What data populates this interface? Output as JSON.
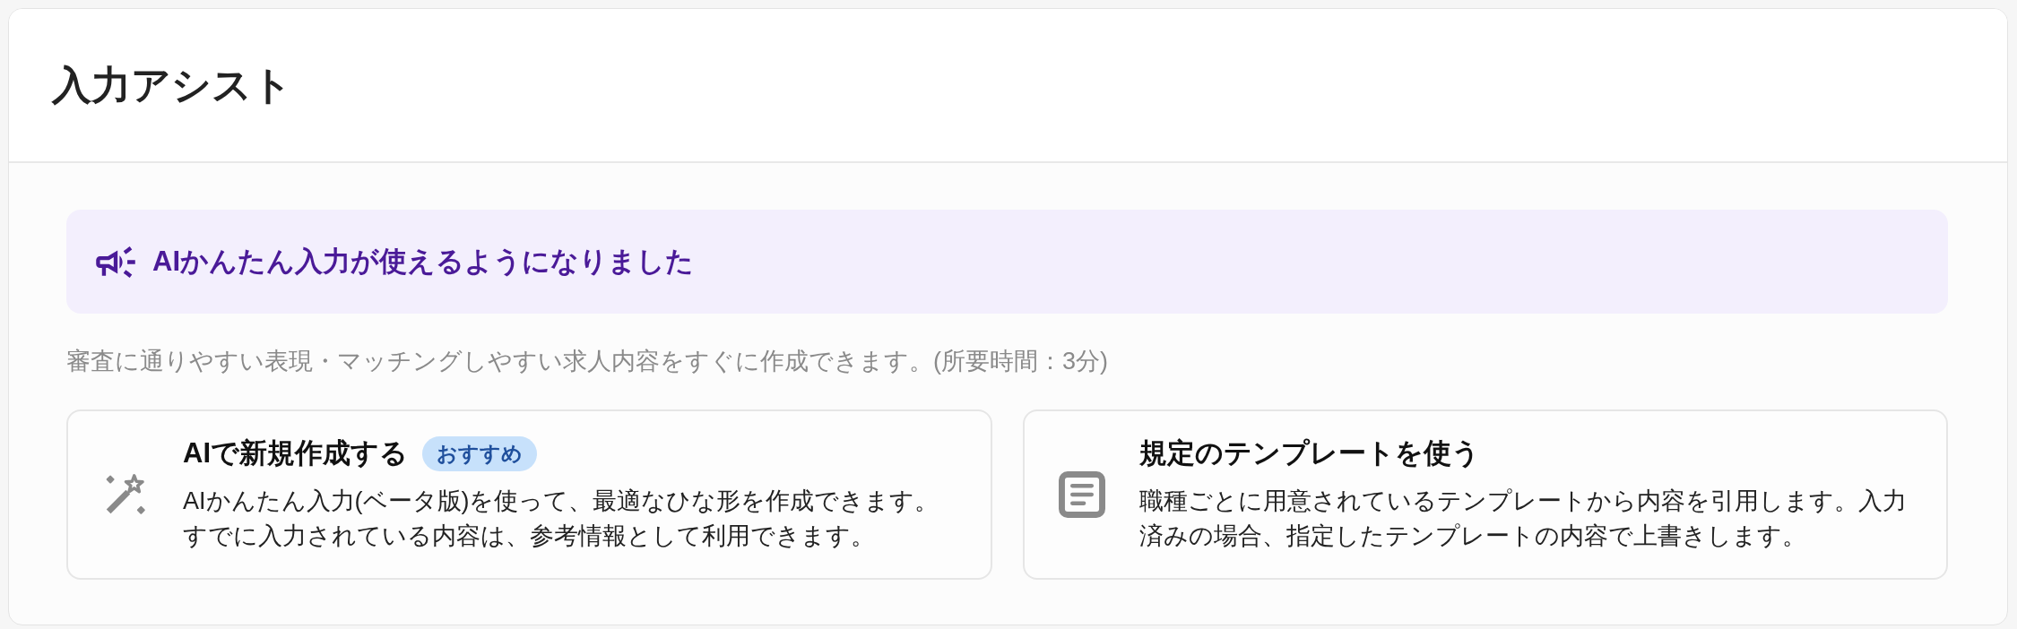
{
  "header": {
    "title": "入力アシスト"
  },
  "announcement": {
    "text": "AIかんたん入力が使えるようになりました"
  },
  "description": "審査に通りやすい表現・マッチングしやすい求人内容をすぐに作成できます。(所要時間：3分)",
  "options": [
    {
      "kind": "ai",
      "title": "AIで新規作成する",
      "badge": "おすすめ",
      "description": [
        "AIかんたん入力(ベータ版)を使って、最適なひな形を作成できます。",
        "すでに入力されている内容は、参考情報として利用できます。"
      ]
    },
    {
      "kind": "template",
      "title": "規定のテンプレートを使う",
      "description": [
        "職種ごとに用意されているテンプレートから内容を引用します。入力済みの場合、指定したテンプレートの内容で上書きします。"
      ]
    }
  ]
}
